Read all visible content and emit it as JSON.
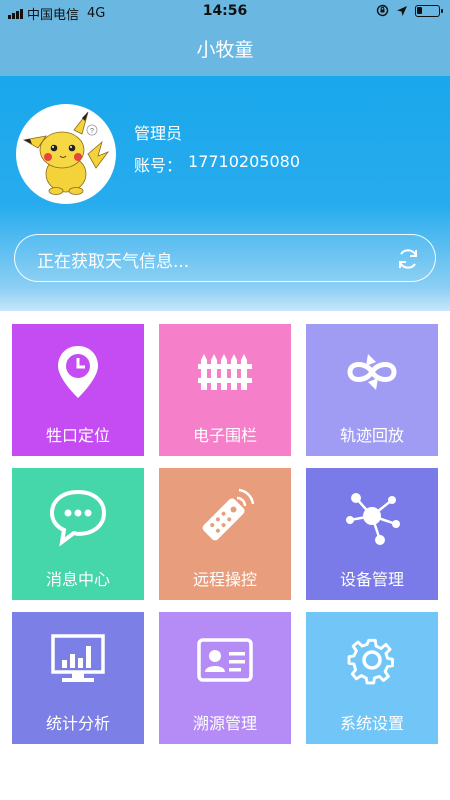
{
  "status_bar": {
    "carrier": "中国电信",
    "network": "4G",
    "time": "14:56"
  },
  "nav": {
    "title": "小牧童"
  },
  "user": {
    "role": "管理员",
    "account_label": "账号：",
    "account_number": "17710205080",
    "avatar_icon": "pikachu-avatar"
  },
  "weather": {
    "text": "正在获取天气信息...",
    "refresh_icon": "refresh-icon"
  },
  "menu": [
    {
      "label": "牲口定位",
      "icon": "location-clock-icon",
      "color": "#c54cf2"
    },
    {
      "label": "电子围栏",
      "icon": "fence-icon",
      "color": "#f57fc8"
    },
    {
      "label": "轨迹回放",
      "icon": "loop-arrows-icon",
      "color": "#a19cf3"
    },
    {
      "label": "消息中心",
      "icon": "chat-bubble-icon",
      "color": "#45d6a9"
    },
    {
      "label": "远程操控",
      "icon": "remote-control-icon",
      "color": "#e89e7c"
    },
    {
      "label": "设备管理",
      "icon": "network-nodes-icon",
      "color": "#7a7ae8"
    },
    {
      "label": "统计分析",
      "icon": "bar-chart-monitor-icon",
      "color": "#7c7fe6"
    },
    {
      "label": "溯源管理",
      "icon": "id-card-icon",
      "color": "#b58bf6"
    },
    {
      "label": "系统设置",
      "icon": "gear-icon",
      "color": "#72c6f7"
    }
  ]
}
